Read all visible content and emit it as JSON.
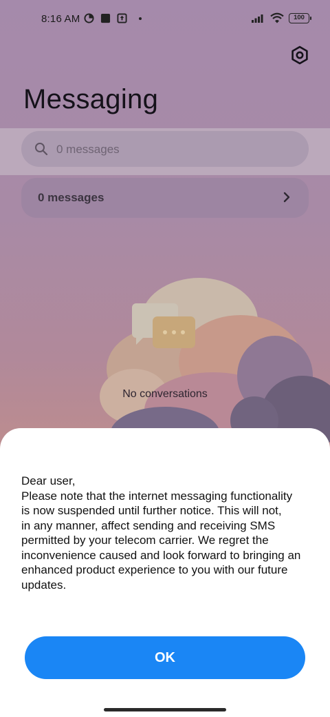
{
  "status_bar": {
    "time": "8:16 AM",
    "battery": "100",
    "icons": [
      "data-saver-icon",
      "square-notification-icon",
      "upload-notification-icon",
      "more-notifications-dot",
      "signal-icon",
      "wifi-icon",
      "battery-icon"
    ]
  },
  "header": {
    "title": "Messaging",
    "settings_icon": "gear-icon"
  },
  "search": {
    "placeholder": "0 messages",
    "icon": "search-icon"
  },
  "messages_row": {
    "label": "0 messages",
    "icon": "chevron-right-icon"
  },
  "empty_state": {
    "text": "No conversations",
    "illustration": "clouds-chat-bubble-illustration"
  },
  "dialog": {
    "lines": [
      "Dear user,",
      "Please note that the internet messaging functionality",
      "is now suspended until further notice. This will not,",
      "in any manner, affect sending and receiving SMS",
      "permitted by your telecom carrier. We regret the",
      "inconvenience caused and look forward to bringing an",
      "enhanced product experience to you with our future",
      "updates."
    ],
    "ok_label": "OK"
  },
  "colors": {
    "accent": "#1a86f5",
    "overlay_background": "#a48ca8",
    "sheet": "#ffffff"
  }
}
